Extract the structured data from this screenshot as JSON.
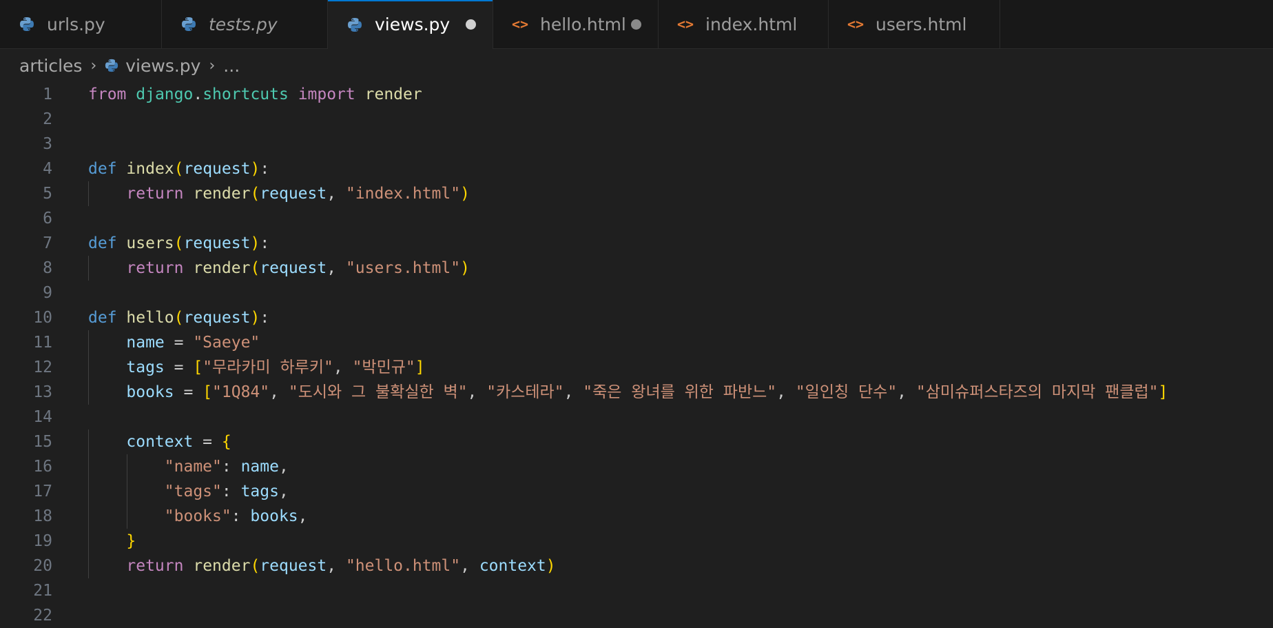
{
  "tabs": [
    {
      "label": "urls.py",
      "type": "python",
      "italic": false,
      "active": false,
      "dirty": false
    },
    {
      "label": "tests.py",
      "type": "python",
      "italic": true,
      "active": false,
      "dirty": false
    },
    {
      "label": "views.py",
      "type": "python",
      "italic": false,
      "active": true,
      "dirty": true
    },
    {
      "label": "hello.html",
      "type": "html",
      "italic": false,
      "active": false,
      "dirty": true
    },
    {
      "label": "index.html",
      "type": "html",
      "italic": false,
      "active": false,
      "dirty": false
    },
    {
      "label": "users.html",
      "type": "html",
      "italic": false,
      "active": false,
      "dirty": false
    }
  ],
  "breadcrumb": {
    "folder": "articles",
    "file": "views.py",
    "more": "..."
  },
  "editor": {
    "line_numbers": [
      "1",
      "2",
      "3",
      "4",
      "5",
      "6",
      "7",
      "8",
      "9",
      "10",
      "11",
      "12",
      "13",
      "14",
      "15",
      "16",
      "17",
      "18",
      "19",
      "20",
      "21",
      "22"
    ],
    "lines": [
      "from django.shortcuts import render",
      "",
      "",
      "def index(request):",
      "    return render(request, \"index.html\")",
      "",
      "def users(request):",
      "    return render(request, \"users.html\")",
      "",
      "def hello(request):",
      "    name = \"Saeye\"",
      "    tags = [\"무라카미 하루키\", \"박민규\"]",
      "    books = [\"1Q84\", \"도시와 그 불확실한 벽\", \"카스테라\", \"죽은 왕녀를 위한 파반느\", \"일인칭 단수\", \"삼미슈퍼스타즈의 마지막 팬클럽\"]",
      "",
      "    context = {",
      "        \"name\": name,",
      "        \"tags\": tags,",
      "        \"books\": books,",
      "    }",
      "    return render(request, \"hello.html\", context)",
      "",
      ""
    ]
  },
  "colors": {
    "accent": "#0078d4",
    "background": "#1f1f1f",
    "tabbar": "#181818",
    "html_icon": "#e37933",
    "python_icon": "#3d7ab3"
  }
}
